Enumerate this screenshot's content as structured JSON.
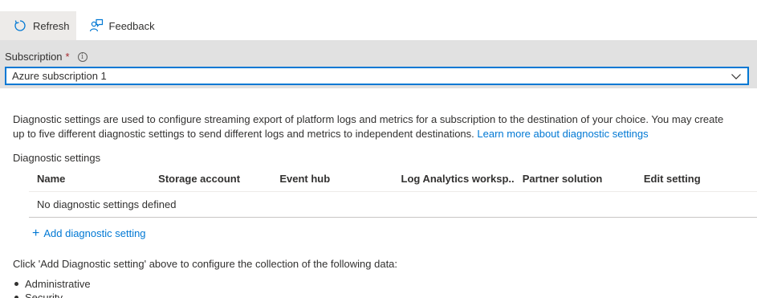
{
  "toolbar": {
    "refresh_label": "Refresh",
    "feedback_label": "Feedback",
    "refresh_icon": "refresh-icon",
    "feedback_icon": "feedback-icon"
  },
  "subscription": {
    "label": "Subscription",
    "required_marker": "*",
    "selected": "Azure subscription 1"
  },
  "description": {
    "text": "Diagnostic settings are used to configure streaming export of platform logs and metrics for a subscription to the destination of your choice. You may create up to five different diagnostic settings to send different logs and metrics to independent destinations.",
    "link": "Learn more about diagnostic settings"
  },
  "diagnostic_settings": {
    "section_label": "Diagnostic settings",
    "columns": [
      "Name",
      "Storage account",
      "Event hub",
      "Log Analytics worksp...",
      "Partner solution",
      "Edit setting"
    ],
    "empty_message": "No diagnostic settings defined",
    "add_label": "Add diagnostic setting"
  },
  "collection": {
    "note": "Click 'Add Diagnostic setting' above to configure the collection of the following data:",
    "items": [
      "Administrative",
      "Security"
    ]
  },
  "colors": {
    "accent": "#0078d4",
    "required": "#a4262c",
    "band": "#e1e1e1"
  }
}
